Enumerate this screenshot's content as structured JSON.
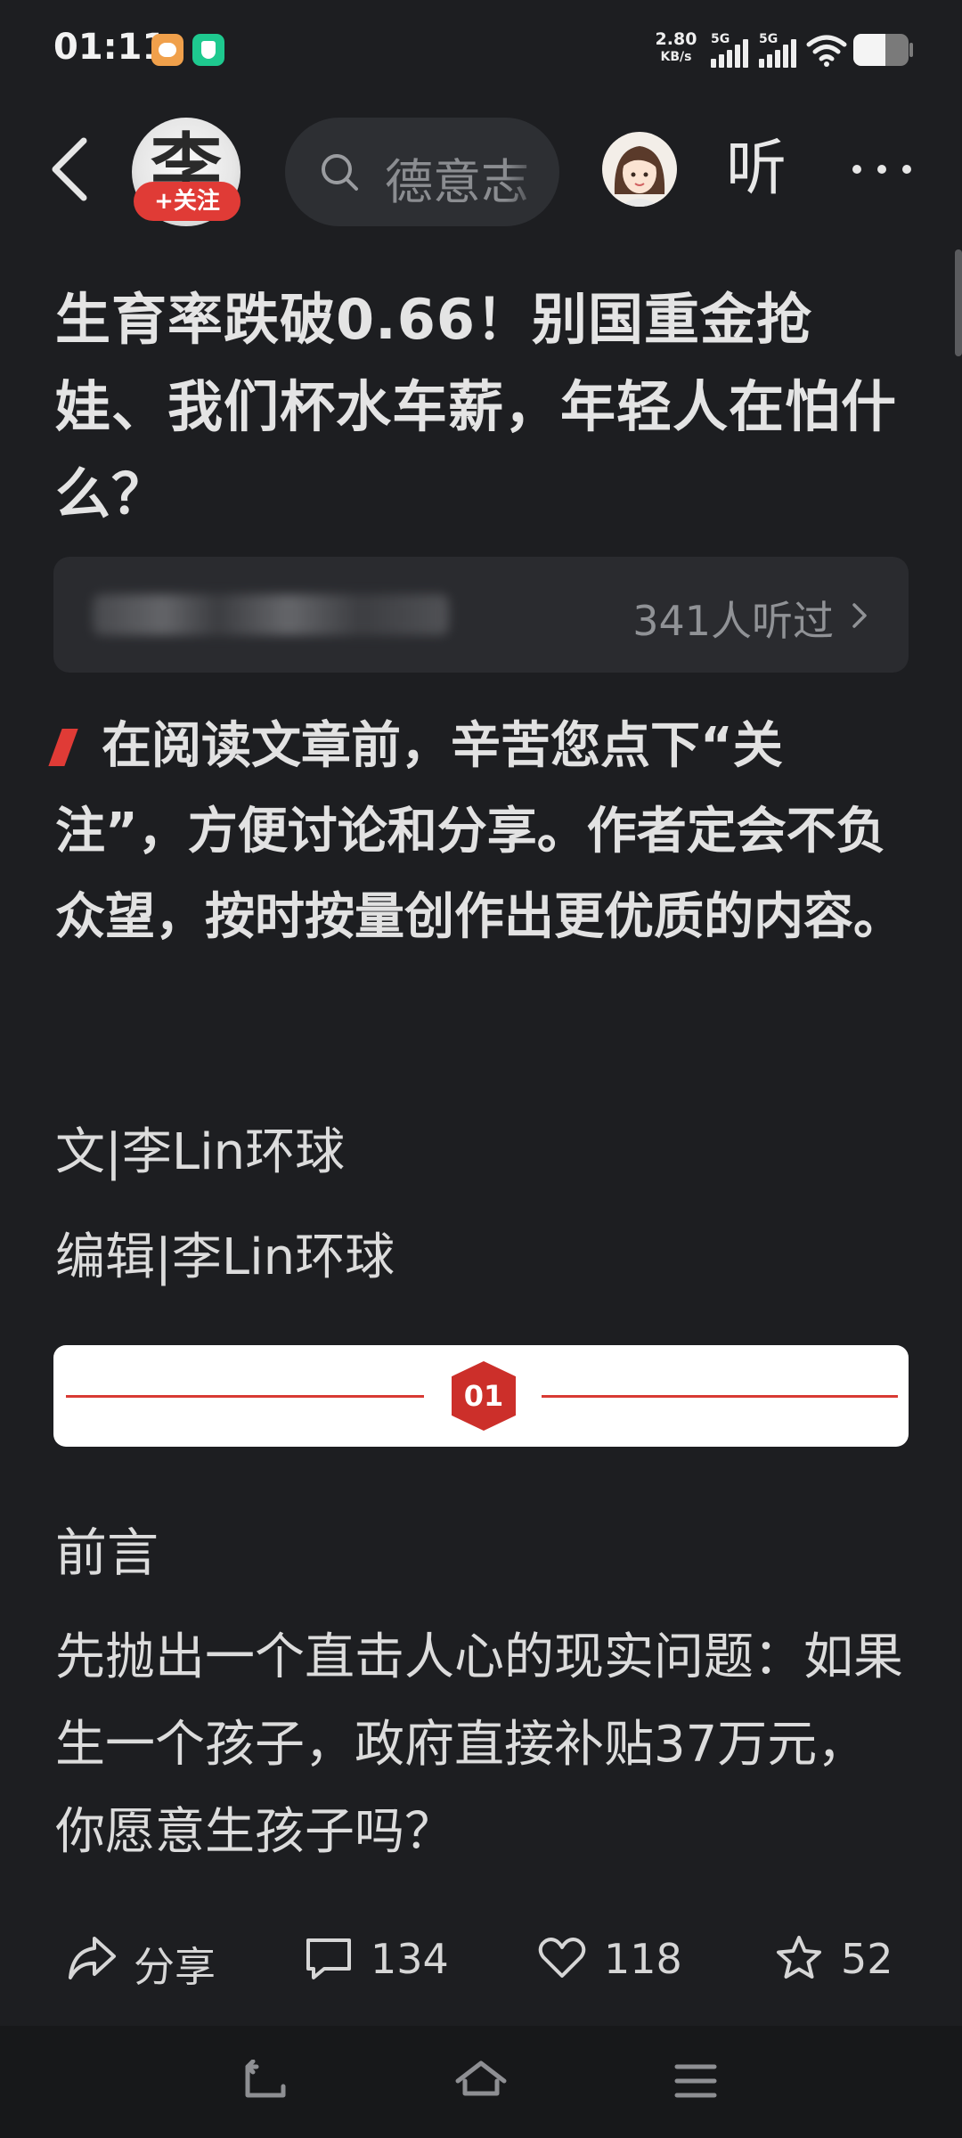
{
  "status_bar": {
    "time": "01:11",
    "speed_value": "2.80",
    "speed_unit": "KB/s",
    "network1": "5G",
    "network2": "5G",
    "battery_level": 0.58
  },
  "nav": {
    "follow_label": "+关注",
    "avatar_glyph": "李",
    "search_placeholder": "德意志",
    "listen_label": "听"
  },
  "article": {
    "title": "生育率跌破0.66！别国重金抢娃、我们杯水车薪，年轻人在怕什么？",
    "listen_count": "341人听过",
    "intro": "在阅读文章前，辛苦您点下“关注”，方便讨论和分享。作者定会不负众望，按时按量创作出更优质的内容。",
    "byline_author": "文|李Lin环球",
    "byline_editor": "编辑|李Lin环球",
    "divider_number": "01",
    "section_heading": "前言",
    "paragraph": "先抛出一个直击人心的现实问题：如果生一个孩子，政府直接补贴37万元，你愿意生孩子吗？"
  },
  "actions": {
    "share": "分享",
    "comments": "134",
    "likes": "118",
    "favorites": "52"
  },
  "colors": {
    "background": "#1d1e21",
    "accent_red": "#e03b36"
  }
}
